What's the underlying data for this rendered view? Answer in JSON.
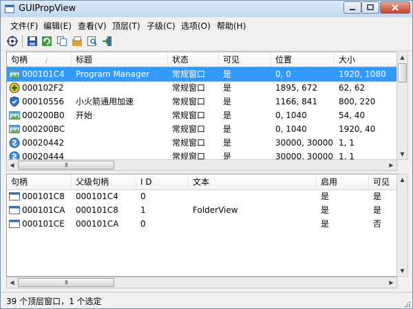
{
  "window": {
    "title": "GUIPropView"
  },
  "menu": [
    {
      "label": "文件(F)"
    },
    {
      "label": "编辑(E)"
    },
    {
      "label": "查看(V)"
    },
    {
      "label": "顶层(T)"
    },
    {
      "label": "子级(C)"
    },
    {
      "label": "选项(O)"
    },
    {
      "label": "帮助(H)"
    }
  ],
  "toolbar": [
    "target-icon",
    "save-icon",
    "refresh-icon",
    "copy-icon",
    "properties-icon",
    "find-icon",
    "exit-icon"
  ],
  "top_table": {
    "columns": [
      "句柄",
      "标题",
      "状态",
      "可见",
      "位置",
      "大小"
    ],
    "sort_indicator": "/",
    "rows": [
      {
        "handle": "000101C4",
        "title": "Program Manager",
        "state": "常规窗口",
        "visible": "是",
        "position": "0, 0",
        "size": "1920, 1080",
        "icon": "desktop-window-icon",
        "selected": true
      },
      {
        "handle": "000102F2",
        "title": "",
        "state": "常规窗口",
        "visible": "是",
        "position": "1895, 672",
        "size": "62, 62",
        "icon": "yellow-circle-app-icon"
      },
      {
        "handle": "00010556",
        "title": "小火箭通用加速",
        "state": "常规窗口",
        "visible": "是",
        "position": "1166, 841",
        "size": "800, 220",
        "icon": "shield-app-icon"
      },
      {
        "handle": "000200B0",
        "title": "开始",
        "state": "常规窗口",
        "visible": "是",
        "position": "0, 1040",
        "size": "54, 40",
        "icon": "desktop-window-icon"
      },
      {
        "handle": "000200BC",
        "title": "",
        "state": "常规窗口",
        "visible": "是",
        "position": "0, 1040",
        "size": "1920, 40",
        "icon": "desktop-window-icon"
      },
      {
        "handle": "00020442",
        "title": "",
        "state": "常规窗口",
        "visible": "是",
        "position": "30000, 30000",
        "size": "1, 1",
        "icon": "blue-swirl-app-icon"
      },
      {
        "handle": "00020444",
        "title": "",
        "state": "常规窗口",
        "visible": "是",
        "position": "30000, 30000",
        "size": "1, 1",
        "icon": "blue-swirl-app-icon"
      }
    ]
  },
  "bottom_table": {
    "columns": [
      "句柄",
      "父级句柄",
      "I D",
      "文本",
      "启用",
      "可见"
    ],
    "rows": [
      {
        "handle": "000101C8",
        "parent": "000101C4",
        "id": "0",
        "text": "",
        "enabled": "是",
        "visible": "是"
      },
      {
        "handle": "000101CA",
        "parent": "000101C8",
        "id": "1",
        "text": "FolderView",
        "enabled": "是",
        "visible": "是"
      },
      {
        "handle": "000101CE",
        "parent": "000101CA",
        "id": "0",
        "text": "",
        "enabled": "是",
        "visible": "否"
      }
    ]
  },
  "status": {
    "text": "39 个顶层窗口，1 个选定"
  },
  "colors": {
    "selection": "#3399ff",
    "title_bar": "#c4d7ee",
    "close_button": "#c5442f"
  }
}
